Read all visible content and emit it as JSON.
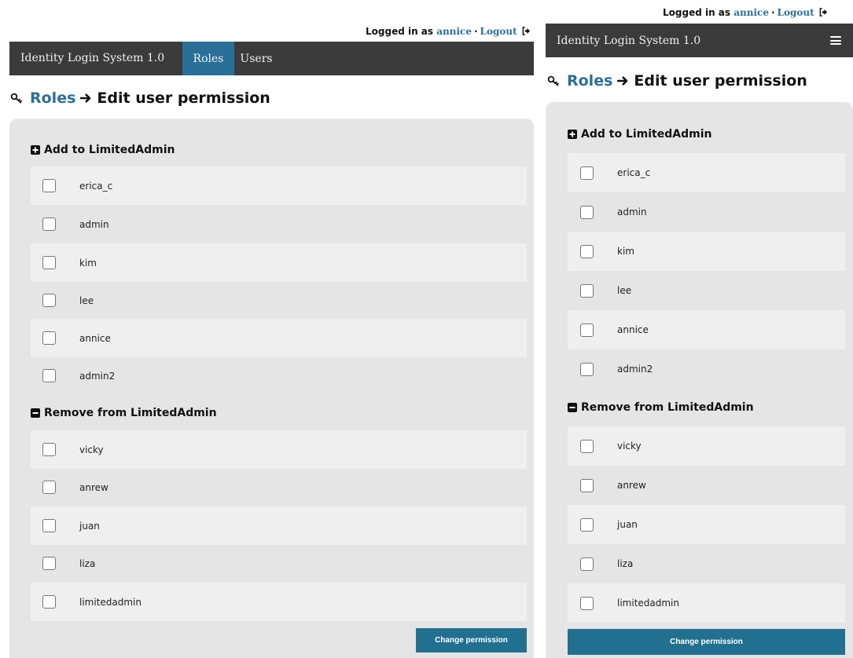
{
  "session": {
    "logged_in_label": "Logged in as",
    "username": "annice",
    "separator": "·",
    "logout_label": "Logout"
  },
  "navbar": {
    "brand": "Identity Login System 1.0",
    "tabs": [
      {
        "label": "Roles",
        "active": true
      },
      {
        "label": "Users",
        "active": false
      }
    ]
  },
  "breadcrumb": {
    "parent": "Roles",
    "current": "Edit user permission"
  },
  "add_section": {
    "title": "Add to LimitedAdmin",
    "users": [
      "erica_c",
      "admin",
      "kim",
      "lee",
      "annice",
      "admin2"
    ]
  },
  "remove_section": {
    "title": "Remove from LimitedAdmin",
    "users": [
      "vicky",
      "anrew",
      "juan",
      "liza",
      "limitedadmin"
    ]
  },
  "actions": {
    "submit_label": "Change permission"
  },
  "colors": {
    "accent": "#2a6f97",
    "navbar": "#3b3b3b",
    "panel": "#e5e5e5",
    "row_alt": "#efefef",
    "button": "#21708f"
  }
}
